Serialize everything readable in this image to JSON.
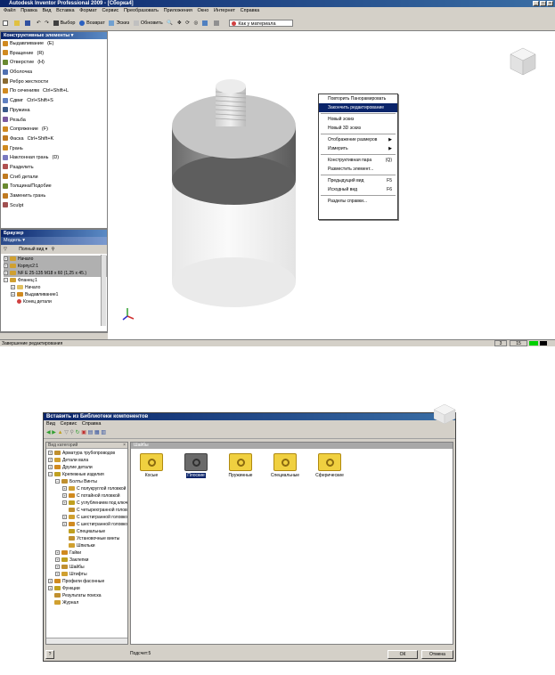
{
  "window": {
    "title": "Autodesk Inventor Professional 2009 - [Сборка4]"
  },
  "menu": [
    "Файл",
    "Правка",
    "Вид",
    "Вставка",
    "Формат",
    "Сервис",
    "Преобразовать",
    "Приложения",
    "Окно",
    "Интернет",
    "Справка"
  ],
  "toolbar": {
    "select": "Выбор",
    "back": "Возврат",
    "sketch": "Эскиз",
    "update": "Обновить",
    "material": "Как у материала"
  },
  "features_panel": {
    "title": "Конструктивные элементы",
    "items": [
      {
        "label": "Выдавливание",
        "key": "(E)",
        "color": "#d08a20"
      },
      {
        "label": "Вращение",
        "key": "(R)",
        "color": "#d08a20"
      },
      {
        "label": "Отверстие",
        "key": "(H)",
        "color": "#6a8a30"
      },
      {
        "label": "Оболочка",
        "key": "",
        "color": "#5070b0"
      },
      {
        "label": "Ребро жесткости",
        "key": "",
        "color": "#8a6a30"
      },
      {
        "label": "По сечениям",
        "key": "Ctrl+Shift+L",
        "color": "#d08a20"
      },
      {
        "label": "Сдвиг",
        "key": "Ctrl+Shift+S",
        "color": "#6080c0"
      },
      {
        "label": "Пружина",
        "key": "",
        "color": "#3a5a8a"
      },
      {
        "label": "Резьба",
        "key": "",
        "color": "#7a5aa0"
      },
      {
        "label": "Сопряжение",
        "key": "(F)",
        "color": "#d08a20"
      },
      {
        "label": "Фаска",
        "key": "Ctrl+Shift+K",
        "color": "#c07a20"
      },
      {
        "label": "Грань",
        "key": "",
        "color": "#d08a20"
      },
      {
        "label": "Наклонная грань",
        "key": "(D)",
        "color": "#7a7ac0"
      },
      {
        "label": "Разделить",
        "key": "",
        "color": "#b05050"
      },
      {
        "label": "Сгиб детали",
        "key": "",
        "color": "#c07a20"
      },
      {
        "label": "Толщина/Подобие",
        "key": "",
        "color": "#6a8a30"
      },
      {
        "label": "Заменить грань",
        "key": "",
        "color": "#c07a20"
      },
      {
        "label": "Sculpt",
        "key": "",
        "color": "#a05050"
      }
    ]
  },
  "browser": {
    "title": "Браузер",
    "model_label": "Модель",
    "view_label": "Полный вид",
    "tree": [
      "Начало",
      "Корпус2:1",
      "NF E 25-135 M18 x 60 (1,25 x 45.)",
      "Фланец:1",
      "Начало",
      "Выдавливание1",
      "Конец детали"
    ]
  },
  "context_menu": {
    "items": [
      {
        "label": "Повторить Панорамировать",
        "key": "",
        "highlight": false
      },
      {
        "label": "Закончить редактирование",
        "key": "",
        "highlight": true
      },
      {
        "label": "Новый эскиз",
        "key": "",
        "highlight": false
      },
      {
        "label": "Новый 3D эскиз",
        "key": "",
        "highlight": false
      },
      {
        "label": "Отображение размеров",
        "key": "▶",
        "highlight": false
      },
      {
        "label": "Измерить",
        "key": "▶",
        "highlight": false
      },
      {
        "label": "Конструктивная пара",
        "key": "(Q)",
        "highlight": false
      },
      {
        "label": "Разместить элемент...",
        "key": "",
        "highlight": false
      },
      {
        "label": "Предыдущий вид",
        "key": "F5",
        "highlight": false
      },
      {
        "label": "Исходный вид",
        "key": "F6",
        "highlight": false
      },
      {
        "label": "Разделы справки...",
        "key": "",
        "highlight": false
      }
    ]
  },
  "status": {
    "text": "Завершение редактирования",
    "n1": "3",
    "n2": "15"
  },
  "dialog": {
    "title": "Вставить из Библиотеки компонентов",
    "menu": [
      "Вид",
      "Сервис",
      "Справка"
    ],
    "left_header": "Вид категорий",
    "right_header": "Шайбы",
    "tree": [
      {
        "label": "Арматура трубопроводов",
        "indent": 0,
        "exp": "+"
      },
      {
        "label": "Детали вала",
        "indent": 0,
        "exp": "+"
      },
      {
        "label": "Другие детали",
        "indent": 0,
        "exp": "+"
      },
      {
        "label": "Крепежные изделия",
        "indent": 0,
        "exp": "−"
      },
      {
        "label": "Болты Винты",
        "indent": 1,
        "exp": "−"
      },
      {
        "label": "С полукруглой головкой",
        "indent": 2,
        "exp": "+"
      },
      {
        "label": "С потайной головкой",
        "indent": 2,
        "exp": "+"
      },
      {
        "label": "С углублением под ключ",
        "indent": 2,
        "exp": "+"
      },
      {
        "label": "С четырехгранной головкой",
        "indent": 2,
        "exp": ""
      },
      {
        "label": "С шестигранной головкой",
        "indent": 2,
        "exp": "+"
      },
      {
        "label": "С шестигранной головкой",
        "indent": 2,
        "exp": "+"
      },
      {
        "label": "Специальные",
        "indent": 2,
        "exp": ""
      },
      {
        "label": "Установочные винты",
        "indent": 2,
        "exp": ""
      },
      {
        "label": "Шпильки",
        "indent": 2,
        "exp": ""
      },
      {
        "label": "Гайки",
        "indent": 1,
        "exp": "+"
      },
      {
        "label": "Заклепки",
        "indent": 1,
        "exp": "+"
      },
      {
        "label": "Шайбы",
        "indent": 1,
        "exp": "+"
      },
      {
        "label": "Штифты",
        "indent": 1,
        "exp": "+"
      },
      {
        "label": "Профили фасонные",
        "indent": 0,
        "exp": "+"
      },
      {
        "label": "Функции",
        "indent": 0,
        "exp": "+"
      },
      {
        "label": "Результаты поиска",
        "indent": 0,
        "exp": ""
      },
      {
        "label": "Журнал",
        "indent": 0,
        "exp": ""
      }
    ],
    "items": [
      {
        "label": "Косые",
        "selected": false
      },
      {
        "label": "Плоские",
        "selected": true
      },
      {
        "label": "Пружинные",
        "selected": false
      },
      {
        "label": "Специальные",
        "selected": false
      },
      {
        "label": "Сферические",
        "selected": false
      }
    ],
    "count": "Подсчет:5",
    "ok": "ОК",
    "cancel": "Отмена"
  }
}
